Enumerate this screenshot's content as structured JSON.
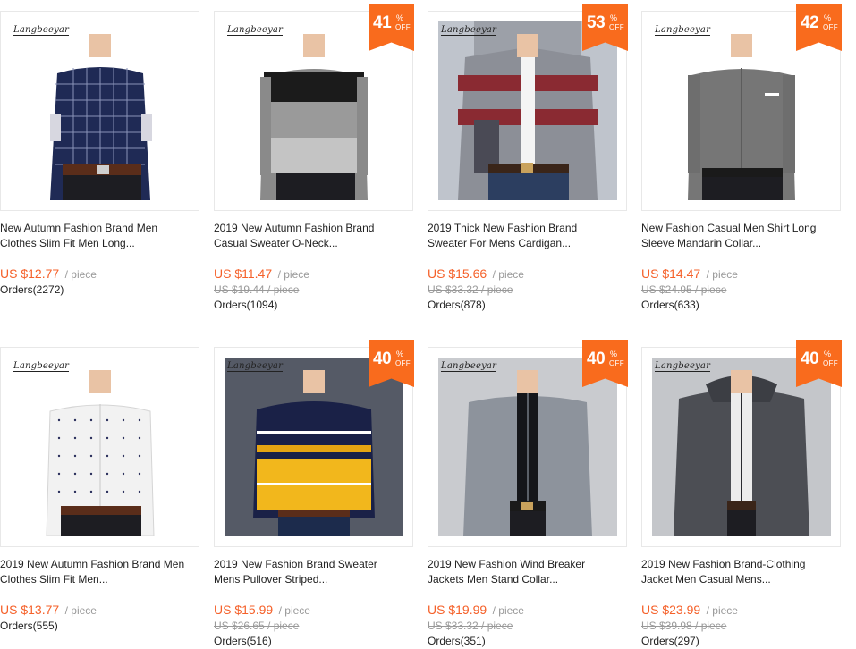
{
  "products": [
    {
      "brand": "Langbeeyar",
      "title_line1": "New Autumn Fashion Brand Men",
      "title_line2": "Clothes Slim Fit Men Long...",
      "price": "US $12.77",
      "unit": "/ piece",
      "old_price": "",
      "orders": "Orders(2272)",
      "discount": "",
      "pct": "",
      "off": "",
      "image": "navy-plaid-shirt"
    },
    {
      "brand": "Langbeeyar",
      "title_line1": "2019 New Autumn Fashion Brand",
      "title_line2": "Casual Sweater O-Neck...",
      "price": "US $11.47",
      "unit": "/ piece",
      "old_price": "US $19.44 / piece",
      "orders": "Orders(1094)",
      "discount": "41",
      "pct": "%",
      "off": "OFF",
      "image": "grey-colorblock-sweater"
    },
    {
      "brand": "Langbeeyar",
      "title_line1": "2019 Thick New Fashion Brand",
      "title_line2": "Sweater For Mens Cardigan...",
      "price": "US $15.66",
      "unit": "/ piece",
      "old_price": "US $33.32 / piece",
      "orders": "Orders(878)",
      "discount": "53",
      "pct": "%",
      "off": "OFF",
      "image": "grey-red-striped-cardigan"
    },
    {
      "brand": "Langbeeyar",
      "title_line1": "New Fashion Casual Men Shirt Long",
      "title_line2": "Sleeve Mandarin Collar...",
      "price": "US $14.47",
      "unit": "/ piece",
      "old_price": "US $24.95 / piece",
      "orders": "Orders(633)",
      "discount": "42",
      "pct": "%",
      "off": "OFF",
      "image": "grey-mandarin-shirt"
    },
    {
      "brand": "Langbeeyar",
      "title_line1": "2019 New Autumn Fashion Brand Men",
      "title_line2": "Clothes Slim Fit Men...",
      "price": "US $13.77",
      "unit": "/ piece",
      "old_price": "",
      "orders": "Orders(555)",
      "discount": "",
      "pct": "",
      "off": "",
      "image": "white-dotted-shirt"
    },
    {
      "brand": "Langbeeyar",
      "title_line1": "2019 New Fashion Brand Sweater",
      "title_line2": "Mens Pullover Striped...",
      "price": "US $15.99",
      "unit": "/ piece",
      "old_price": "US $26.65 / piece",
      "orders": "Orders(516)",
      "discount": "40",
      "pct": "%",
      "off": "OFF",
      "image": "navy-yellow-striped-sweater"
    },
    {
      "brand": "Langbeeyar",
      "title_line1": "2019 New Fashion Wind Breaker",
      "title_line2": "Jackets Men Stand Collar...",
      "price": "US $19.99",
      "unit": "/ piece",
      "old_price": "US $33.32 / piece",
      "orders": "Orders(351)",
      "discount": "40",
      "pct": "%",
      "off": "OFF",
      "image": "grey-zip-jacket"
    },
    {
      "brand": "Langbeeyar",
      "title_line1": "2019 New Fashion Brand-Clothing",
      "title_line2": "Jacket Men Casual Mens...",
      "price": "US $23.99",
      "unit": "/ piece",
      "old_price": "US $39.98 / piece",
      "orders": "Orders(297)",
      "discount": "40",
      "pct": "%",
      "off": "OFF",
      "image": "charcoal-hooded-jacket"
    }
  ],
  "colors": {
    "accent": "#f96b1d",
    "price": "#f5612a",
    "muted": "#999999"
  }
}
